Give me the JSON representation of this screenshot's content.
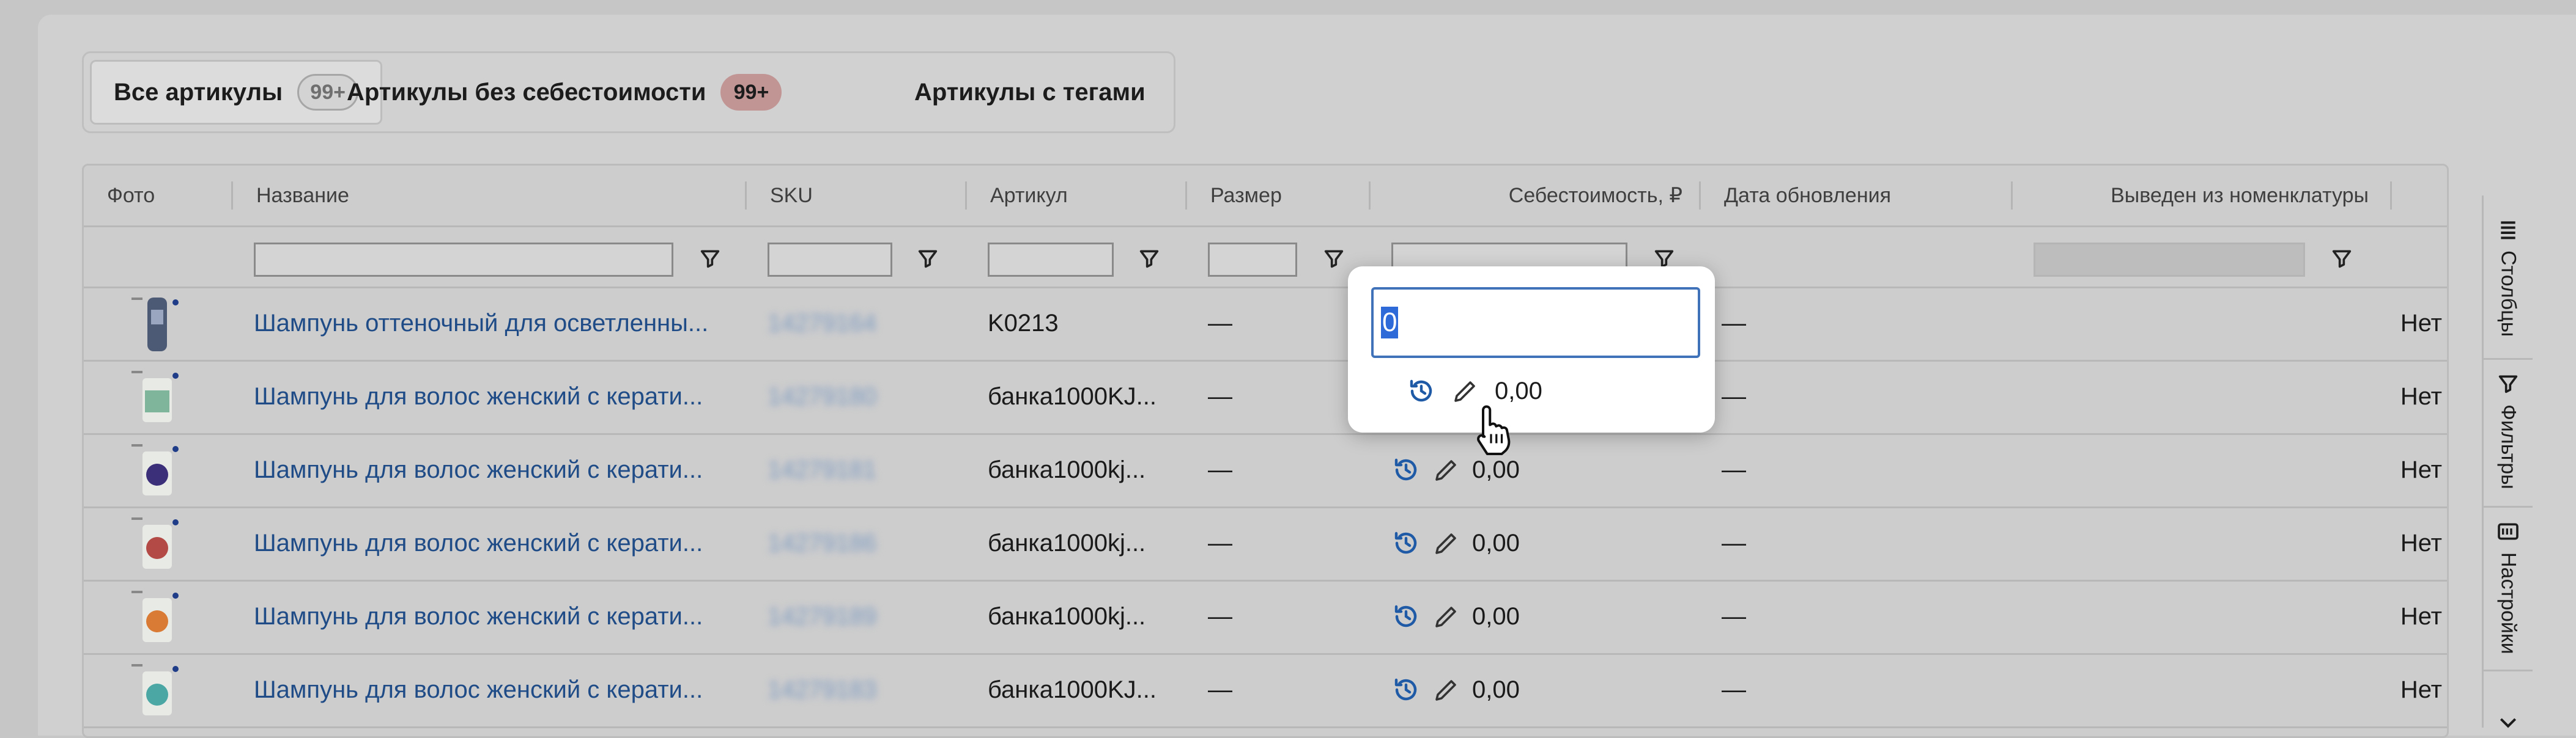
{
  "tabs": [
    {
      "label": "Все артикулы",
      "badge": "99+"
    },
    {
      "label": "Артикулы без себестоимости",
      "badge": "99+"
    },
    {
      "label": "Артикулы с тегами"
    }
  ],
  "columns": [
    "Фото",
    "Название",
    "SKU",
    "Артикул",
    "Размер",
    "Себестоимость, ₽",
    "Дата обновления",
    "Выведен из номенклатуры"
  ],
  "rows": [
    {
      "name": "Шампунь оттеночный для осветленны...",
      "sku": "14279164",
      "article": "K0213",
      "size": "—",
      "cost": "",
      "date": "—",
      "excluded": "Нет",
      "thumb_color": "#4d5a75"
    },
    {
      "name": "Шампунь для волос женский с керати...",
      "sku": "14279180",
      "article": "банка1000KJ...",
      "size": "—",
      "cost": "0,00",
      "date": "—",
      "excluded": "Нет",
      "thumb_color": "#7fb59a"
    },
    {
      "name": "Шампунь для волос женский с керати...",
      "sku": "14279181",
      "article": "банка1000kj...",
      "size": "—",
      "cost": "0,00",
      "date": "—",
      "excluded": "Нет",
      "thumb_color": "#3b2f7a"
    },
    {
      "name": "Шампунь для волос женский с керати...",
      "sku": "14279186",
      "article": "банка1000kj...",
      "size": "—",
      "cost": "0,00",
      "date": "—",
      "excluded": "Нет",
      "thumb_color": "#b44a45"
    },
    {
      "name": "Шампунь для волос женский с керати...",
      "sku": "14279189",
      "article": "банка1000kj...",
      "size": "—",
      "cost": "0,00",
      "date": "—",
      "excluded": "Нет",
      "thumb_color": "#d97b35"
    },
    {
      "name": "Шампунь для волос женский с керати...",
      "sku": "14279183",
      "article": "банка1000KJ...",
      "size": "—",
      "cost": "0,00",
      "date": "—",
      "excluded": "Нет",
      "thumb_color": "#4aa7a4"
    }
  ],
  "popup": {
    "input_value": "0",
    "cost": "0,00"
  },
  "sidebar": [
    {
      "label": "Столбцы",
      "icon": "columns-icon"
    },
    {
      "label": "Фильтры",
      "icon": "filter-icon"
    },
    {
      "label": "Настройки",
      "icon": "settings-icon"
    }
  ],
  "colors": {
    "link": "#1f4b86",
    "accent": "#2f6bd8",
    "history_icon": "#1f5aa6",
    "red_badge": "#c29595"
  }
}
